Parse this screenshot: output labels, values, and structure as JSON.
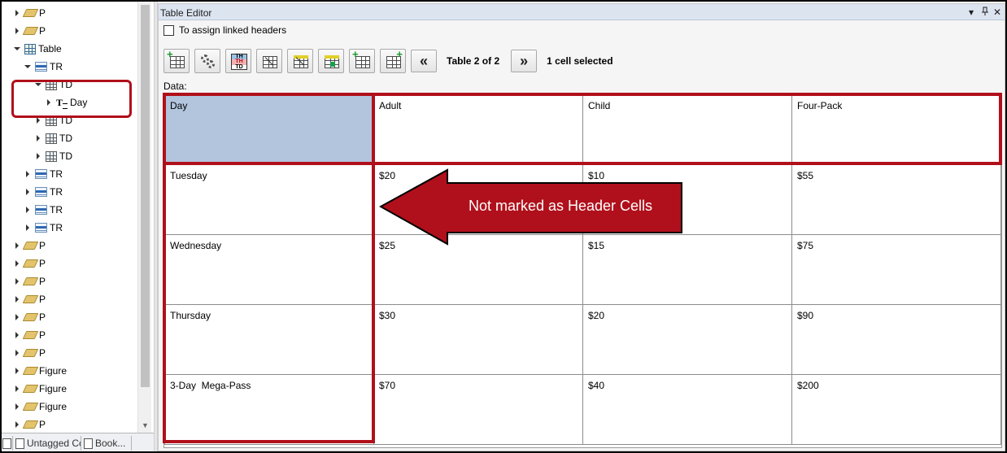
{
  "tree": {
    "items": [
      {
        "label": "P",
        "depth": 1,
        "icon": "tag-icon",
        "expanded": false
      },
      {
        "label": "P",
        "depth": 1,
        "icon": "tag-icon",
        "expanded": false
      },
      {
        "label": "Table",
        "depth": 1,
        "icon": "table-icon",
        "expanded": true
      },
      {
        "label": "TR",
        "depth": 2,
        "icon": "tr-icon",
        "expanded": true
      },
      {
        "label": "TD",
        "depth": 3,
        "icon": "td-icon",
        "expanded": true
      },
      {
        "label": "Day",
        "depth": 4,
        "icon": "text-icon",
        "expanded": false
      },
      {
        "label": "TD",
        "depth": 3,
        "icon": "td-icon",
        "expanded": false
      },
      {
        "label": "TD",
        "depth": 3,
        "icon": "td-icon",
        "expanded": false
      },
      {
        "label": "TD",
        "depth": 3,
        "icon": "td-icon",
        "expanded": false
      },
      {
        "label": "TR",
        "depth": 2,
        "icon": "tr-icon",
        "expanded": false
      },
      {
        "label": "TR",
        "depth": 2,
        "icon": "tr-icon",
        "expanded": false
      },
      {
        "label": "TR",
        "depth": 2,
        "icon": "tr-icon",
        "expanded": false
      },
      {
        "label": "TR",
        "depth": 2,
        "icon": "tr-icon",
        "expanded": false
      },
      {
        "label": "P",
        "depth": 1,
        "icon": "tag-icon",
        "expanded": false
      },
      {
        "label": "P",
        "depth": 1,
        "icon": "tag-icon",
        "expanded": false
      },
      {
        "label": "P",
        "depth": 1,
        "icon": "tag-icon",
        "expanded": false
      },
      {
        "label": "P",
        "depth": 1,
        "icon": "tag-icon",
        "expanded": false
      },
      {
        "label": "P",
        "depth": 1,
        "icon": "tag-icon",
        "expanded": false
      },
      {
        "label": "P",
        "depth": 1,
        "icon": "tag-icon",
        "expanded": false
      },
      {
        "label": "P",
        "depth": 1,
        "icon": "tag-icon",
        "expanded": false
      },
      {
        "label": "Figure",
        "depth": 1,
        "icon": "tag-icon",
        "expanded": false
      },
      {
        "label": "Figure",
        "depth": 1,
        "icon": "tag-icon",
        "expanded": false
      },
      {
        "label": "Figure",
        "depth": 1,
        "icon": "tag-icon",
        "expanded": false
      }
    ],
    "partial_top": "P",
    "partial_bottom": "P"
  },
  "bottom_tabs": [
    "Untagged Co...",
    "Book..."
  ],
  "editor": {
    "title": "Table Editor",
    "controls": {
      "dropdown": "▾",
      "pin": "⭎",
      "close": "✕"
    },
    "linked_headers_label": "To assign linked headers",
    "table_count": "Table 2 of 2",
    "cell_selected": "1 cell selected",
    "prev_symbol": "«",
    "next_symbol": "»",
    "data_label": "Data:"
  },
  "grid": {
    "rows": [
      [
        "Day",
        "Adult",
        "Child",
        "Four-Pack"
      ],
      [
        "Tuesday",
        "$20",
        "$10",
        "$55"
      ],
      [
        "Wednesday",
        "$25",
        "$15",
        "$75"
      ],
      [
        "Thursday",
        "$30",
        "$20",
        "$90"
      ],
      [
        "3-Day  Mega-Pass",
        "$70",
        "$40",
        "$200"
      ]
    ],
    "selected_cell": [
      0,
      0
    ]
  },
  "callout": {
    "text": "Not marked as Header Cells"
  },
  "colors": {
    "accent_red": "#b0101b",
    "selected_cell": "#b2c5dd",
    "title_bar": "#dce4f0"
  }
}
